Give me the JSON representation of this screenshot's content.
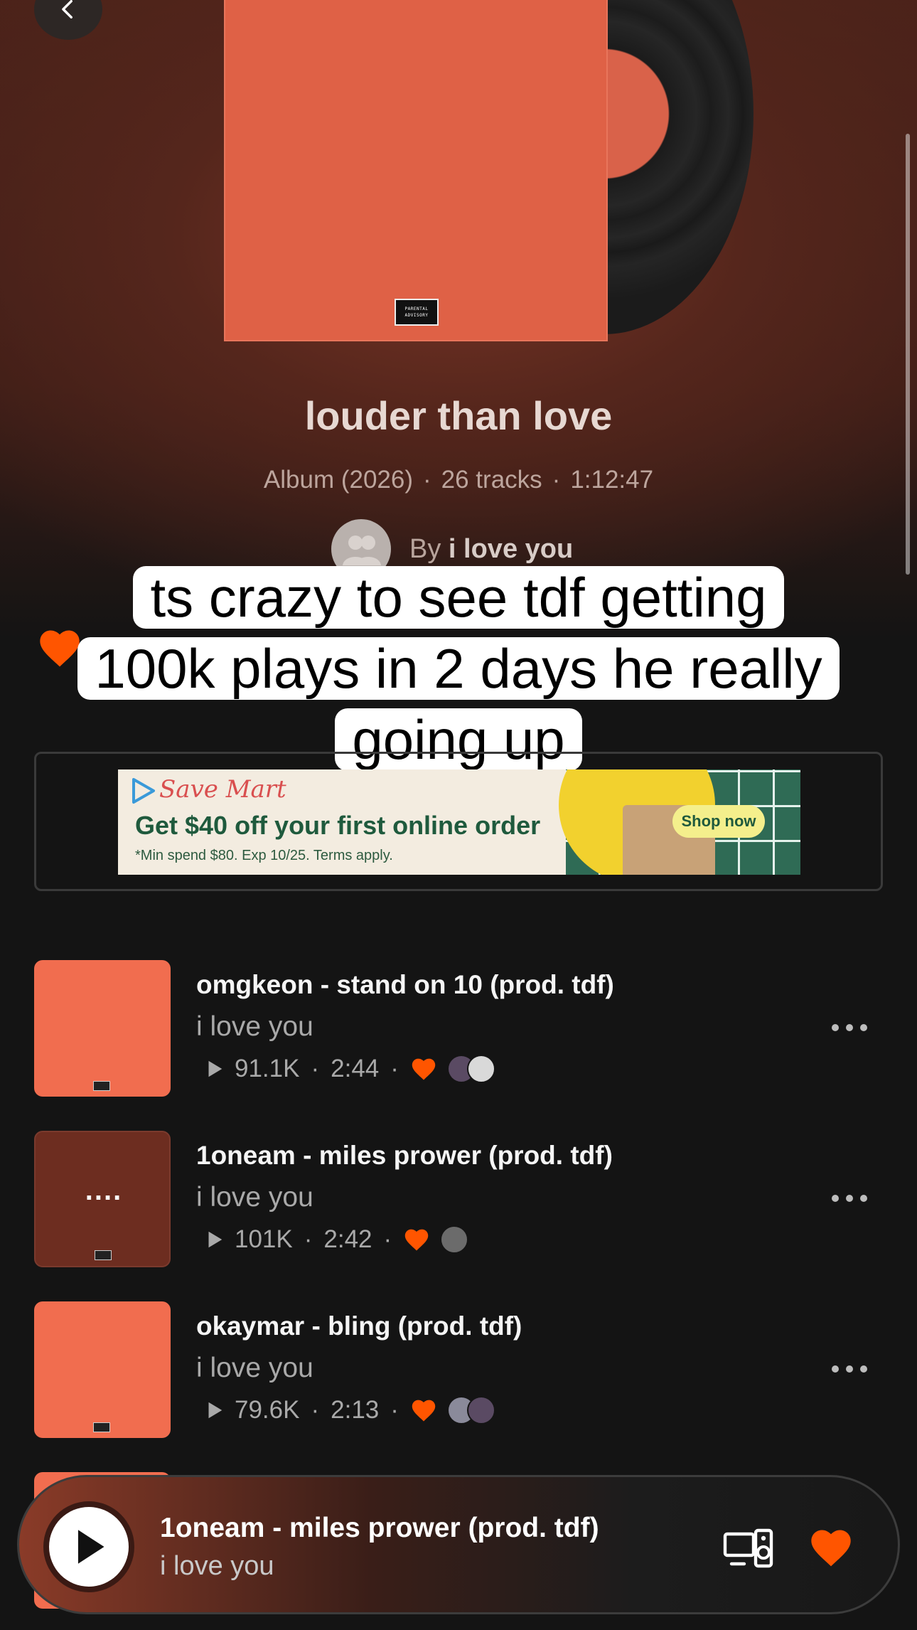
{
  "album": {
    "title": "louder than love",
    "type_year": "Album (2026)",
    "tracks_count": "26 tracks",
    "duration": "1:12:47",
    "by_prefix": "By",
    "artist": "i love you",
    "advisory_text": "PARENTAL ADVISORY"
  },
  "caption": {
    "line1": "ts crazy to see tdf getting",
    "line2": "100k plays in 2 days he really",
    "line3": "going up"
  },
  "ad": {
    "brand": "Save Mart",
    "headline": "Get $40 off your first online order",
    "fine_print": "*Min spend $80. Exp 10/25. Terms apply.",
    "cta": "Shop now"
  },
  "tracks": [
    {
      "title": "omgkeon - stand on 10 (prod. tdf)",
      "artist": "i love you",
      "plays": "91.1K",
      "duration": "2:44"
    },
    {
      "title": "1oneam - miles prower (prod. tdf)",
      "artist": "i love you",
      "plays": "101K",
      "duration": "2:42",
      "thumb_overlay": "...."
    },
    {
      "title": "okaymar - bling (prod. tdf)",
      "artist": "i love you",
      "plays": "79.6K",
      "duration": "2:13"
    }
  ],
  "player": {
    "title": "1oneam - miles prower (prod. tdf)",
    "artist": "i love you"
  },
  "colors": {
    "accent": "#ff5500",
    "cover": "#df6146",
    "background": "#141414"
  }
}
